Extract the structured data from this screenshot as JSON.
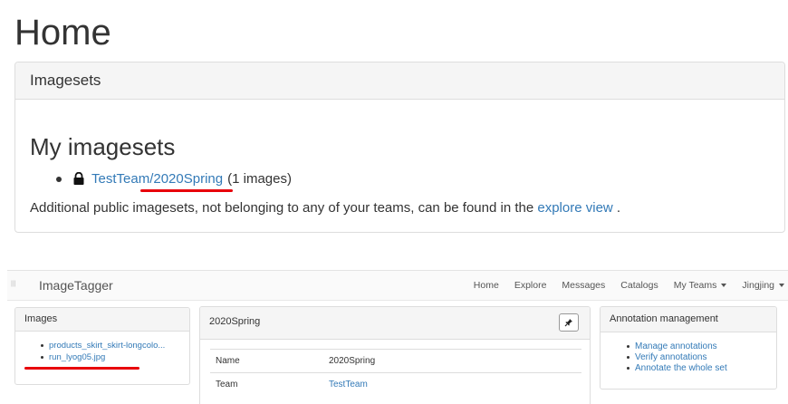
{
  "home": {
    "title": "Home",
    "panel_header": "Imagesets",
    "my_imagesets_title": "My imagesets",
    "imageset": {
      "team": "TestTeam",
      "separator": "/",
      "name": "2020Spring",
      "count": "(1 images)"
    },
    "additional_text": "Additional public imagesets, not belonging to any of your teams, can be found in the",
    "explore_link": "explore view",
    "period": "."
  },
  "app": {
    "brand": "ImageTagger",
    "nav": {
      "home": "Home",
      "explore": "Explore",
      "messages": "Messages",
      "catalogs": "Catalogs",
      "my_teams": "My Teams",
      "user": "Jingjing"
    },
    "images_panel": {
      "title": "Images",
      "items": [
        "products_skirt_skirt-longcolo...",
        "run_lyog05.jpg"
      ]
    },
    "imageset_panel": {
      "title": "2020Spring",
      "pin_label": "📌",
      "rows": [
        {
          "label": "Name",
          "value": "2020Spring"
        },
        {
          "label": "Team",
          "value": "TestTeam"
        }
      ]
    },
    "annotation_panel": {
      "title": "Annotation management",
      "items": [
        "Manage annotations",
        "Verify annotations",
        "Annotate the whole set"
      ]
    }
  },
  "colors": {
    "link": "#337ab7",
    "highlight": "#e8000a",
    "panel_header_bg": "#f5f5f5"
  }
}
